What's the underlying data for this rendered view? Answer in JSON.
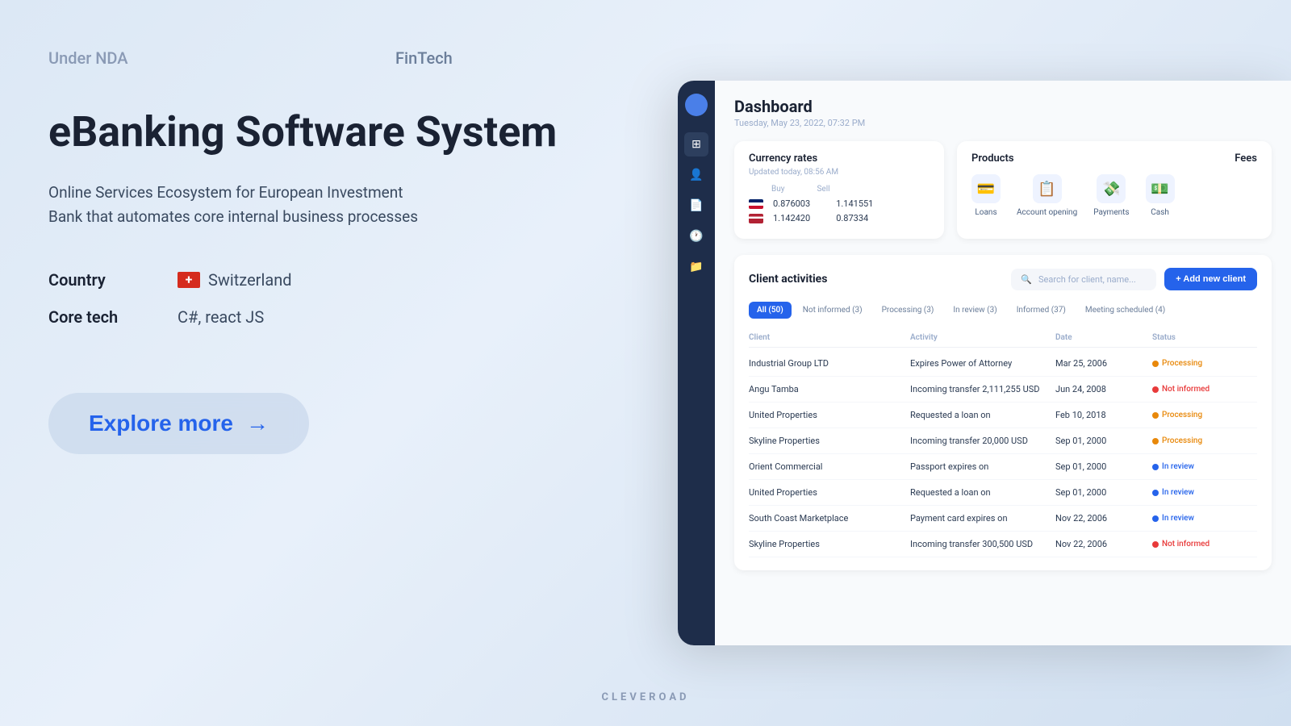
{
  "page": {
    "background": "#dce8f5"
  },
  "left": {
    "nda_label": "Under NDA",
    "fintech_label": "FinTech",
    "title": "eBanking Software System",
    "subtitle_line1": "Online Services Ecosystem for European Investment",
    "subtitle_line2": "Bank that automates core internal business processes",
    "country_label": "Country",
    "country_value": "Switzerland",
    "tech_label": "Core tech",
    "tech_value": "C#, react JS",
    "explore_label": "Explore more",
    "explore_arrow": "→"
  },
  "dashboard": {
    "title": "Dashboard",
    "subtitle": "Tuesday, May 23, 2022,  07:32 PM",
    "currency": {
      "title": "Currency rates",
      "updated": "Updated today, 08:56 AM",
      "buy_label": "Buy",
      "sell_label": "Sell",
      "rates": [
        {
          "flag": "gb",
          "buy": "0.876003",
          "sell": "1.141551"
        },
        {
          "flag": "us",
          "buy": "1.142420",
          "sell": "0.87334"
        }
      ]
    },
    "products": {
      "title": "Products",
      "items": [
        {
          "icon": "💳",
          "label": "Loans"
        },
        {
          "icon": "📋",
          "label": "Account opening"
        },
        {
          "icon": "💸",
          "label": "Payments"
        },
        {
          "icon": "💵",
          "label": "Cash"
        }
      ]
    },
    "fees": {
      "title": "Fees"
    },
    "activities": {
      "title": "Client activities",
      "search_placeholder": "Search for client, name...",
      "add_btn": "+ Add new client",
      "tabs": [
        {
          "label": "All (50)",
          "active": true
        },
        {
          "label": "Not informed (3)",
          "active": false
        },
        {
          "label": "Processing (3)",
          "active": false
        },
        {
          "label": "In review (3)",
          "active": false
        },
        {
          "label": "Informed (37)",
          "active": false
        },
        {
          "label": "Meeting scheduled (4)",
          "active": false
        }
      ],
      "columns": [
        "Client",
        "Activity",
        "Date",
        "Status"
      ],
      "rows": [
        {
          "client": "Industrial Group LTD",
          "activity": "Expires Power of Attorney",
          "date": "Mar 25, 2006",
          "status": "Processing",
          "status_type": "processing"
        },
        {
          "client": "Angu Tamba",
          "activity": "Incoming transfer 2,111,255 USD",
          "date": "Jun 24, 2008",
          "status": "Not informed",
          "status_type": "not-informed"
        },
        {
          "client": "United Properties",
          "activity": "Requested a loan on",
          "date": "Feb 10, 2018",
          "status": "Processing",
          "status_type": "processing"
        },
        {
          "client": "Skyline Properties",
          "activity": "Incoming transfer 20,000 USD",
          "date": "Sep 01, 2000",
          "status": "Processing",
          "status_type": "processing"
        },
        {
          "client": "Orient Commercial",
          "activity": "Passport expires on",
          "date": "Sep 01, 2000",
          "status": "In review",
          "status_type": "in-review"
        },
        {
          "client": "United Properties",
          "activity": "Requested a loan on",
          "date": "Sep 01, 2000",
          "status": "In review",
          "status_type": "in-review"
        },
        {
          "client": "South Coast Marketplace",
          "activity": "Payment card expires on",
          "date": "Nov 22, 2006",
          "status": "In review",
          "status_type": "in-review"
        },
        {
          "client": "Skyline Properties",
          "activity": "Incoming transfer 300,500 USD",
          "date": "Nov 22, 2006",
          "status": "Not informed",
          "status_type": "not-informed"
        }
      ]
    }
  },
  "footer": {
    "label": "CLEVEROAD"
  }
}
